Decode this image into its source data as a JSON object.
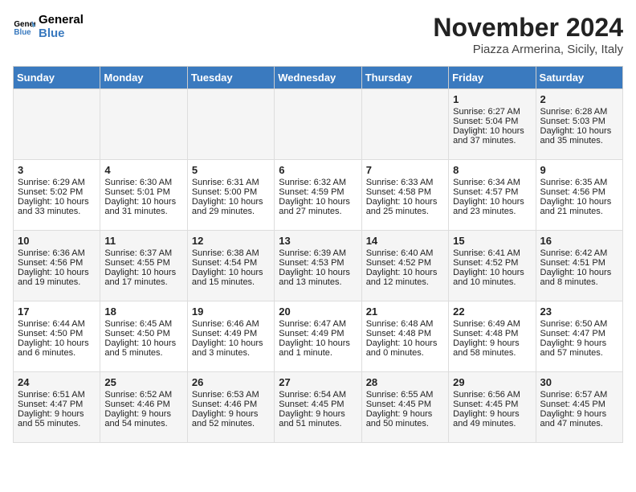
{
  "header": {
    "logo_general": "General",
    "logo_blue": "Blue",
    "month_year": "November 2024",
    "location": "Piazza Armerina, Sicily, Italy"
  },
  "weekdays": [
    "Sunday",
    "Monday",
    "Tuesday",
    "Wednesday",
    "Thursday",
    "Friday",
    "Saturday"
  ],
  "weeks": [
    [
      {
        "day": "",
        "sunrise": "",
        "sunset": "",
        "daylight": ""
      },
      {
        "day": "",
        "sunrise": "",
        "sunset": "",
        "daylight": ""
      },
      {
        "day": "",
        "sunrise": "",
        "sunset": "",
        "daylight": ""
      },
      {
        "day": "",
        "sunrise": "",
        "sunset": "",
        "daylight": ""
      },
      {
        "day": "",
        "sunrise": "",
        "sunset": "",
        "daylight": ""
      },
      {
        "day": "1",
        "sunrise": "Sunrise: 6:27 AM",
        "sunset": "Sunset: 5:04 PM",
        "daylight": "Daylight: 10 hours and 37 minutes."
      },
      {
        "day": "2",
        "sunrise": "Sunrise: 6:28 AM",
        "sunset": "Sunset: 5:03 PM",
        "daylight": "Daylight: 10 hours and 35 minutes."
      }
    ],
    [
      {
        "day": "3",
        "sunrise": "Sunrise: 6:29 AM",
        "sunset": "Sunset: 5:02 PM",
        "daylight": "Daylight: 10 hours and 33 minutes."
      },
      {
        "day": "4",
        "sunrise": "Sunrise: 6:30 AM",
        "sunset": "Sunset: 5:01 PM",
        "daylight": "Daylight: 10 hours and 31 minutes."
      },
      {
        "day": "5",
        "sunrise": "Sunrise: 6:31 AM",
        "sunset": "Sunset: 5:00 PM",
        "daylight": "Daylight: 10 hours and 29 minutes."
      },
      {
        "day": "6",
        "sunrise": "Sunrise: 6:32 AM",
        "sunset": "Sunset: 4:59 PM",
        "daylight": "Daylight: 10 hours and 27 minutes."
      },
      {
        "day": "7",
        "sunrise": "Sunrise: 6:33 AM",
        "sunset": "Sunset: 4:58 PM",
        "daylight": "Daylight: 10 hours and 25 minutes."
      },
      {
        "day": "8",
        "sunrise": "Sunrise: 6:34 AM",
        "sunset": "Sunset: 4:57 PM",
        "daylight": "Daylight: 10 hours and 23 minutes."
      },
      {
        "day": "9",
        "sunrise": "Sunrise: 6:35 AM",
        "sunset": "Sunset: 4:56 PM",
        "daylight": "Daylight: 10 hours and 21 minutes."
      }
    ],
    [
      {
        "day": "10",
        "sunrise": "Sunrise: 6:36 AM",
        "sunset": "Sunset: 4:56 PM",
        "daylight": "Daylight: 10 hours and 19 minutes."
      },
      {
        "day": "11",
        "sunrise": "Sunrise: 6:37 AM",
        "sunset": "Sunset: 4:55 PM",
        "daylight": "Daylight: 10 hours and 17 minutes."
      },
      {
        "day": "12",
        "sunrise": "Sunrise: 6:38 AM",
        "sunset": "Sunset: 4:54 PM",
        "daylight": "Daylight: 10 hours and 15 minutes."
      },
      {
        "day": "13",
        "sunrise": "Sunrise: 6:39 AM",
        "sunset": "Sunset: 4:53 PM",
        "daylight": "Daylight: 10 hours and 13 minutes."
      },
      {
        "day": "14",
        "sunrise": "Sunrise: 6:40 AM",
        "sunset": "Sunset: 4:52 PM",
        "daylight": "Daylight: 10 hours and 12 minutes."
      },
      {
        "day": "15",
        "sunrise": "Sunrise: 6:41 AM",
        "sunset": "Sunset: 4:52 PM",
        "daylight": "Daylight: 10 hours and 10 minutes."
      },
      {
        "day": "16",
        "sunrise": "Sunrise: 6:42 AM",
        "sunset": "Sunset: 4:51 PM",
        "daylight": "Daylight: 10 hours and 8 minutes."
      }
    ],
    [
      {
        "day": "17",
        "sunrise": "Sunrise: 6:44 AM",
        "sunset": "Sunset: 4:50 PM",
        "daylight": "Daylight: 10 hours and 6 minutes."
      },
      {
        "day": "18",
        "sunrise": "Sunrise: 6:45 AM",
        "sunset": "Sunset: 4:50 PM",
        "daylight": "Daylight: 10 hours and 5 minutes."
      },
      {
        "day": "19",
        "sunrise": "Sunrise: 6:46 AM",
        "sunset": "Sunset: 4:49 PM",
        "daylight": "Daylight: 10 hours and 3 minutes."
      },
      {
        "day": "20",
        "sunrise": "Sunrise: 6:47 AM",
        "sunset": "Sunset: 4:49 PM",
        "daylight": "Daylight: 10 hours and 1 minute."
      },
      {
        "day": "21",
        "sunrise": "Sunrise: 6:48 AM",
        "sunset": "Sunset: 4:48 PM",
        "daylight": "Daylight: 10 hours and 0 minutes."
      },
      {
        "day": "22",
        "sunrise": "Sunrise: 6:49 AM",
        "sunset": "Sunset: 4:48 PM",
        "daylight": "Daylight: 9 hours and 58 minutes."
      },
      {
        "day": "23",
        "sunrise": "Sunrise: 6:50 AM",
        "sunset": "Sunset: 4:47 PM",
        "daylight": "Daylight: 9 hours and 57 minutes."
      }
    ],
    [
      {
        "day": "24",
        "sunrise": "Sunrise: 6:51 AM",
        "sunset": "Sunset: 4:47 PM",
        "daylight": "Daylight: 9 hours and 55 minutes."
      },
      {
        "day": "25",
        "sunrise": "Sunrise: 6:52 AM",
        "sunset": "Sunset: 4:46 PM",
        "daylight": "Daylight: 9 hours and 54 minutes."
      },
      {
        "day": "26",
        "sunrise": "Sunrise: 6:53 AM",
        "sunset": "Sunset: 4:46 PM",
        "daylight": "Daylight: 9 hours and 52 minutes."
      },
      {
        "day": "27",
        "sunrise": "Sunrise: 6:54 AM",
        "sunset": "Sunset: 4:45 PM",
        "daylight": "Daylight: 9 hours and 51 minutes."
      },
      {
        "day": "28",
        "sunrise": "Sunrise: 6:55 AM",
        "sunset": "Sunset: 4:45 PM",
        "daylight": "Daylight: 9 hours and 50 minutes."
      },
      {
        "day": "29",
        "sunrise": "Sunrise: 6:56 AM",
        "sunset": "Sunset: 4:45 PM",
        "daylight": "Daylight: 9 hours and 49 minutes."
      },
      {
        "day": "30",
        "sunrise": "Sunrise: 6:57 AM",
        "sunset": "Sunset: 4:45 PM",
        "daylight": "Daylight: 9 hours and 47 minutes."
      }
    ]
  ]
}
